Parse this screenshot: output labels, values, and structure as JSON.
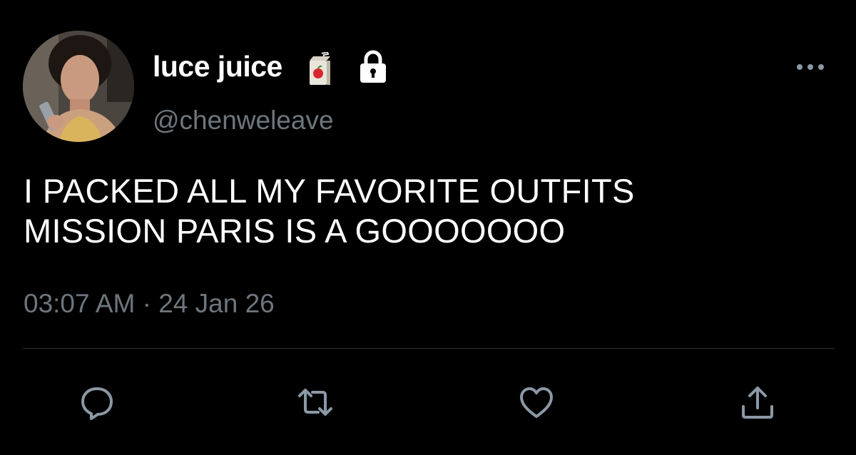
{
  "tweet": {
    "display_name": "luce juice",
    "badge_icon": "juice-box-icon",
    "protected_icon": "lock-icon",
    "handle": "@chenweleave",
    "text_lines": [
      "I PACKED ALL MY FAVORITE OUTFITS",
      "MISSION PARIS IS A GOOOOOOO"
    ],
    "timestamp": "03:07 AM · 24 Jan 26"
  },
  "actions": {
    "icons": [
      "reply-icon",
      "retweet-icon",
      "like-icon",
      "share-icon"
    ]
  },
  "colors": {
    "background": "#000000",
    "primary_text": "#ffffff",
    "secondary_text": "#6e767d",
    "icon": "#8b98a5",
    "divider": "#2f3336"
  }
}
